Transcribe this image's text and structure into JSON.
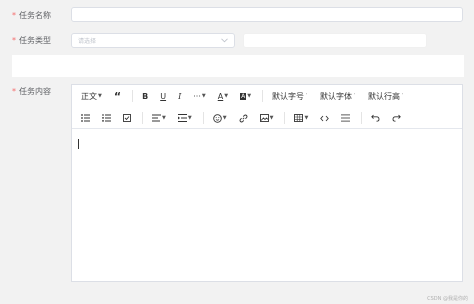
{
  "form": {
    "task_name": {
      "label": "任务名称",
      "required_mark": "*",
      "value": ""
    },
    "task_type": {
      "label": "任务类型",
      "required_mark": "*",
      "placeholder": "请选择",
      "value": ""
    },
    "task_content": {
      "label": "任务内容",
      "required_mark": "*"
    }
  },
  "editor": {
    "toolbar": {
      "paragraph_label": "正文",
      "font_size_label": "默认字号",
      "font_family_label": "默认字体",
      "line_height_label": "默认行高"
    },
    "content": ""
  },
  "watermark": "CSDN @我是你的"
}
